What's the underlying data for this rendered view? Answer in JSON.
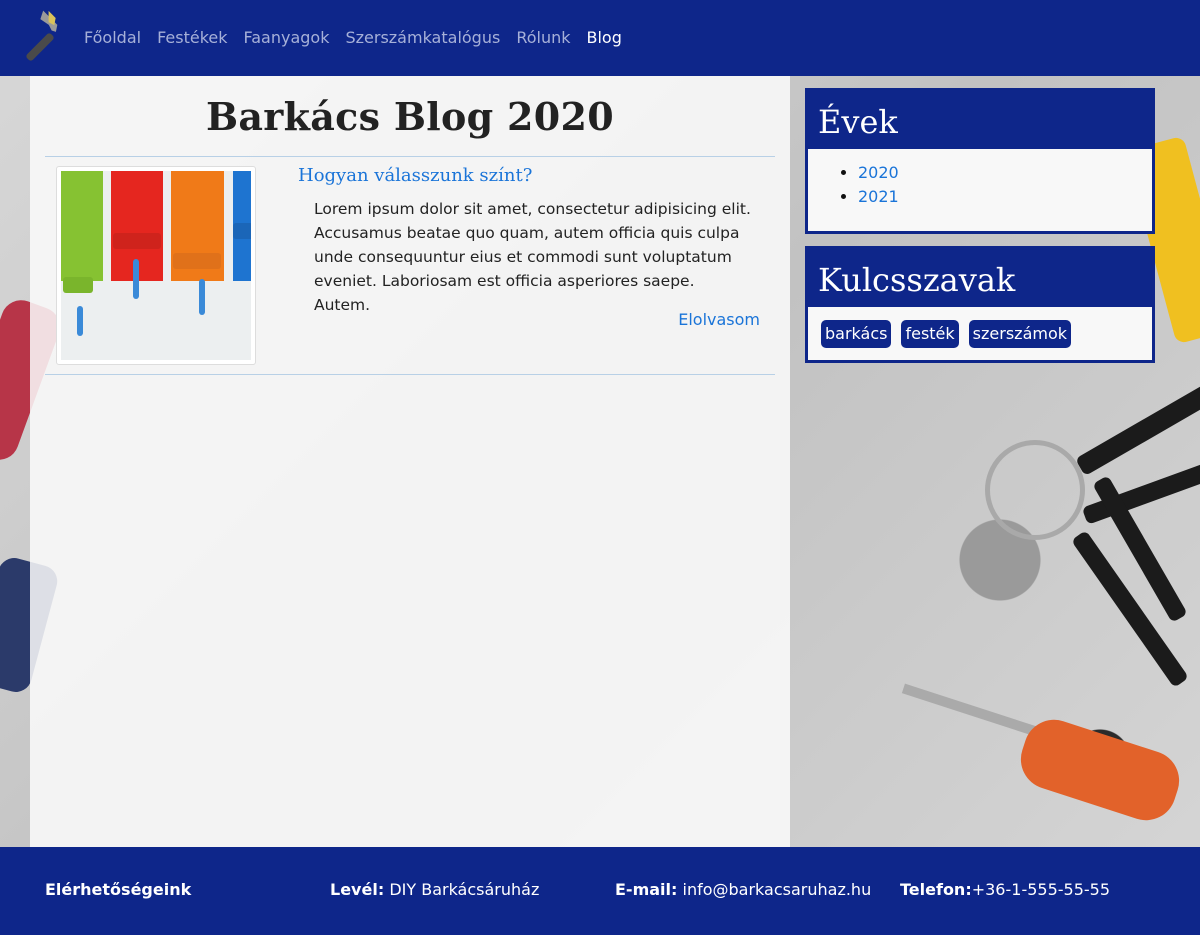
{
  "nav": {
    "items": [
      {
        "label": "Főoldal"
      },
      {
        "label": "Festékek"
      },
      {
        "label": "Faanyagok"
      },
      {
        "label": "Szerszámkatalógus"
      },
      {
        "label": "Rólunk"
      },
      {
        "label": "Blog"
      }
    ],
    "active": "Blog",
    "logo_icon": "hammer-icon"
  },
  "main": {
    "title": "Barkács Blog 2020",
    "posts": [
      {
        "title": "Hogyan válasszunk színt?",
        "excerpt": "Lorem ipsum dolor sit amet, consectetur adipisicing elit. Accusamus beatae quo quam, autem officia quis culpa unde consequuntur eius et commodi sunt voluptatum eveniet. Laboriosam est officia asperiores saepe. Autem.",
        "read_more": "Elolvasom",
        "image": "paint-rollers-image"
      }
    ]
  },
  "sidebar": {
    "years": {
      "title": "Évek",
      "items": [
        "2020",
        "2021"
      ]
    },
    "keywords": {
      "title": "Kulcsszavak",
      "tags": [
        "barkács",
        "festék",
        "szerszámok"
      ]
    }
  },
  "footer": {
    "contacts_title": "Elérhetőségeink",
    "mail_label": "Levél:",
    "mail_value": "DIY Barkácsáruház",
    "email_label": "E-mail:",
    "email_value": "info@barkacsaruhaz.hu",
    "phone_label": "Telefon:",
    "phone_value": "+36-1-555-55-55"
  },
  "colors": {
    "brand": "#0e268a",
    "link": "#1a74d8"
  }
}
